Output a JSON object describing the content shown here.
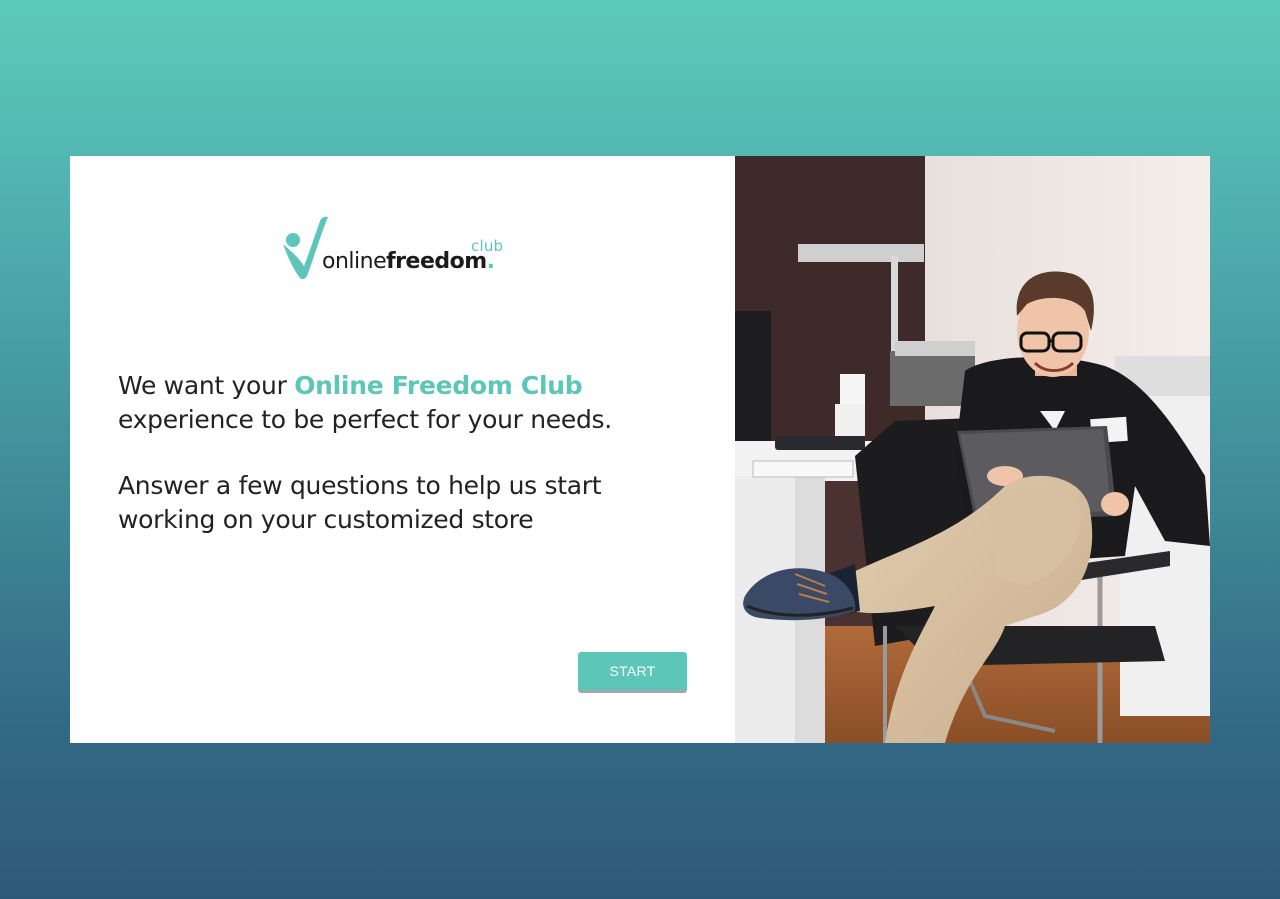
{
  "logo": {
    "club": "club",
    "online": "online",
    "freedom": "freedom",
    "dot": "."
  },
  "intro": {
    "line_prefix": "We want your ",
    "brand": "Online Freedom Club",
    "line_suffix": "experience to be perfect for your needs.",
    "sub": "Answer a few questions to help us start working on your customized store"
  },
  "actions": {
    "start_label": "START"
  },
  "colors": {
    "accent": "#5cc7b8",
    "text": "#222222",
    "button_shadow": "#9fa8ab"
  }
}
